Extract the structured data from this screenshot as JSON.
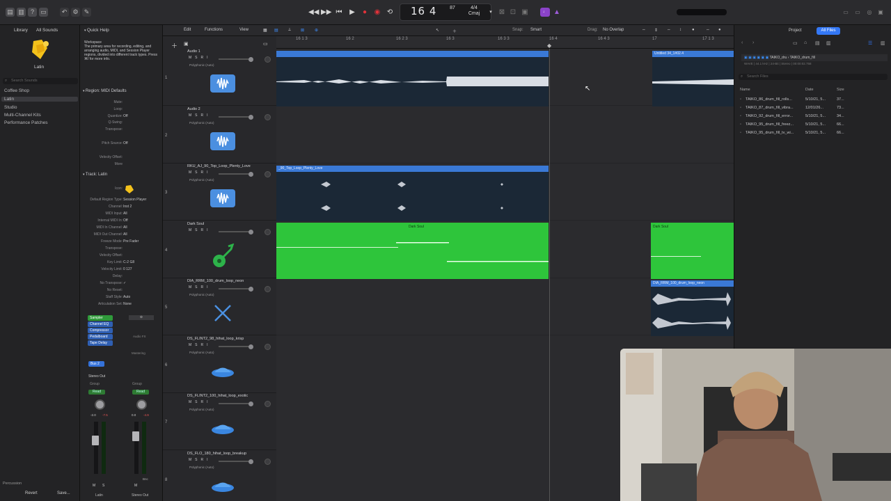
{
  "transport": {
    "position": "16 4",
    "tempo_value": "87",
    "tempo_label": "",
    "signature": "4/4",
    "key": "Cmaj"
  },
  "library": {
    "title": "Library",
    "filter": "All Sounds",
    "patch_name": "Latin",
    "search_placeholder": "Search Sounds",
    "categories": [
      "Coffee Shop",
      "Latin",
      "Studio",
      "Multi-Channel Kits",
      "Performance Patches"
    ],
    "footer": "Percussion",
    "revert": "Revert",
    "save": "Save..."
  },
  "inspector": {
    "quick_help": "Quick Help",
    "help_title": "Workspace",
    "help_body": "The primary area for recording, editing, and arranging audio, MIDI, and Session Player regions, divided into different track types. Press ⌘/ for more info.",
    "region_header": "Region: MIDI Defaults",
    "region_rows": [
      {
        "label": "Mute:",
        "value": ""
      },
      {
        "label": "Loop:",
        "value": ""
      },
      {
        "label": "Quantize:",
        "value": "Off"
      },
      {
        "label": "Q-Swing:",
        "value": ""
      },
      {
        "label": "Transpose:",
        "value": ""
      },
      {
        "label": "Pitch Source:",
        "value": "Off"
      },
      {
        "label": "Velocity Offset:",
        "value": ""
      },
      {
        "label": "More",
        "value": ""
      }
    ],
    "track_header": "Track: Latin",
    "track_rows": [
      {
        "label": "Icon:",
        "value": ""
      },
      {
        "label": "Default Region Type:",
        "value": "Session Player"
      },
      {
        "label": "Channel:",
        "value": "Inst 2"
      },
      {
        "label": "MIDI Input:",
        "value": "All"
      },
      {
        "label": "Internal MIDI In:",
        "value": "Off"
      },
      {
        "label": "MIDI In Channel:",
        "value": "All"
      },
      {
        "label": "MIDI Out Channel:",
        "value": "All"
      },
      {
        "label": "Freeze Mode:",
        "value": "Pre Fader"
      },
      {
        "label": "Transpose:",
        "value": ""
      },
      {
        "label": "Velocity Offset:",
        "value": ""
      },
      {
        "label": "Key Limit:",
        "value": "C-2  G8"
      },
      {
        "label": "Velocity Limit:",
        "value": "0  127"
      },
      {
        "label": "Delay:",
        "value": ""
      },
      {
        "label": "No Transpose:",
        "value": "✓"
      },
      {
        "label": "No Reset:",
        "value": ""
      },
      {
        "label": "Staff Style:",
        "value": "Auto"
      },
      {
        "label": "Articulation Set:",
        "value": "None"
      }
    ],
    "plugins": [
      "Sampler",
      "Channel EQ",
      "Compressor",
      "Pedalboard",
      "Tape Delay"
    ],
    "send": "Bus 2",
    "output": "Stereo Out",
    "group": "Group",
    "read": "Read",
    "fader_left": "-2.0",
    "fader_left2": "-7.5",
    "fader_right": "0.0",
    "fader_right2": "-4.9",
    "channel_left": "Latin",
    "channel_right": "Stereo Out",
    "bnc": "Bnc"
  },
  "toolbar": {
    "edit": "Edit",
    "functions": "Functions",
    "view": "View",
    "snap_label": "Snap:",
    "snap_value": "Smart",
    "drag_label": "Drag:",
    "drag_value": "No Overlap"
  },
  "ruler": [
    "16 1 3",
    "16 2",
    "16 2 3",
    "16 3",
    "16 3 3",
    "16 4",
    "16 4 3",
    "17",
    "17 1 3"
  ],
  "tracks": [
    {
      "num": "1",
      "name": "Audio 1",
      "mode": "Polyphonic (Auto)",
      "icon": "waveform-icon"
    },
    {
      "num": "2",
      "name": "Audio 2",
      "mode": "Polyphonic (Auto)",
      "icon": "waveform-icon"
    },
    {
      "num": "3",
      "name": "RKU_AJ_90_Top_Loop_Plenty_Love",
      "mode": "Polyphonic (Auto)",
      "icon": "waveform-icon"
    },
    {
      "num": "4",
      "name": "Dark Soul",
      "mode": "",
      "icon": "guitar-icon"
    },
    {
      "num": "5",
      "name": "DIA_RRM_100_drum_loop_neon",
      "mode": "Polyphonic (Auto)",
      "icon": "sticks-icon"
    },
    {
      "num": "6",
      "name": "DS_FLINT2_98_hihat_loop_krisp",
      "mode": "Polyphonic (Auto)",
      "icon": "cymbal-icon"
    },
    {
      "num": "7",
      "name": "DS_FLINT2_100_hihat_loop_exotic",
      "mode": "Polyphonic (Auto)",
      "icon": "cymbal-icon"
    },
    {
      "num": "8",
      "name": "DS_FLO_180_hihat_loop_breakup",
      "mode": "Polyphonic (Auto)",
      "icon": "cymbal-icon"
    }
  ],
  "regions": {
    "r1_title": "Untitled 34_1#02.4",
    "r3_title": "_90_Top_Loop_Plenty_Love",
    "r4a_title": "Dark Soul",
    "r4b_title": "Dark Soul",
    "r5_title": "DIA_RRM_100_drum_loop_neon"
  },
  "browser": {
    "tab_project": "Project",
    "tab_all_files": "All Files",
    "path": "TAIKO_dru",
    "path2": "TAIKO_drum_fill",
    "info": "WAVE | 44.1 kHz | 24-Bit | Stereo | 00:00:02.758",
    "search_placeholder": "Search Files",
    "col_name": "Name",
    "col_date": "Date",
    "col_size": "Size",
    "files": [
      {
        "name": "TAIKO_86_drum_fill_rolls...",
        "date": "5/10/21, 5...",
        "size": "37..."
      },
      {
        "name": "TAIKO_87_drum_fill_vibra...",
        "date": "12/01/26...",
        "size": "73..."
      },
      {
        "name": "TAIKO_92_drum_fill_error...",
        "date": "5/10/21, 5...",
        "size": "34..."
      },
      {
        "name": "TAIKO_95_drum_fill_freez...",
        "date": "5/10/21, 5...",
        "size": "66..."
      },
      {
        "name": "TAIKO_95_drum_fill_tv_wi...",
        "date": "5/10/21, 5...",
        "size": "66..."
      }
    ]
  },
  "colors": {
    "region_blue": "#3a79d6",
    "region_green": "#2ec53b",
    "accent": "#3478f6",
    "record": "#e0323a"
  }
}
